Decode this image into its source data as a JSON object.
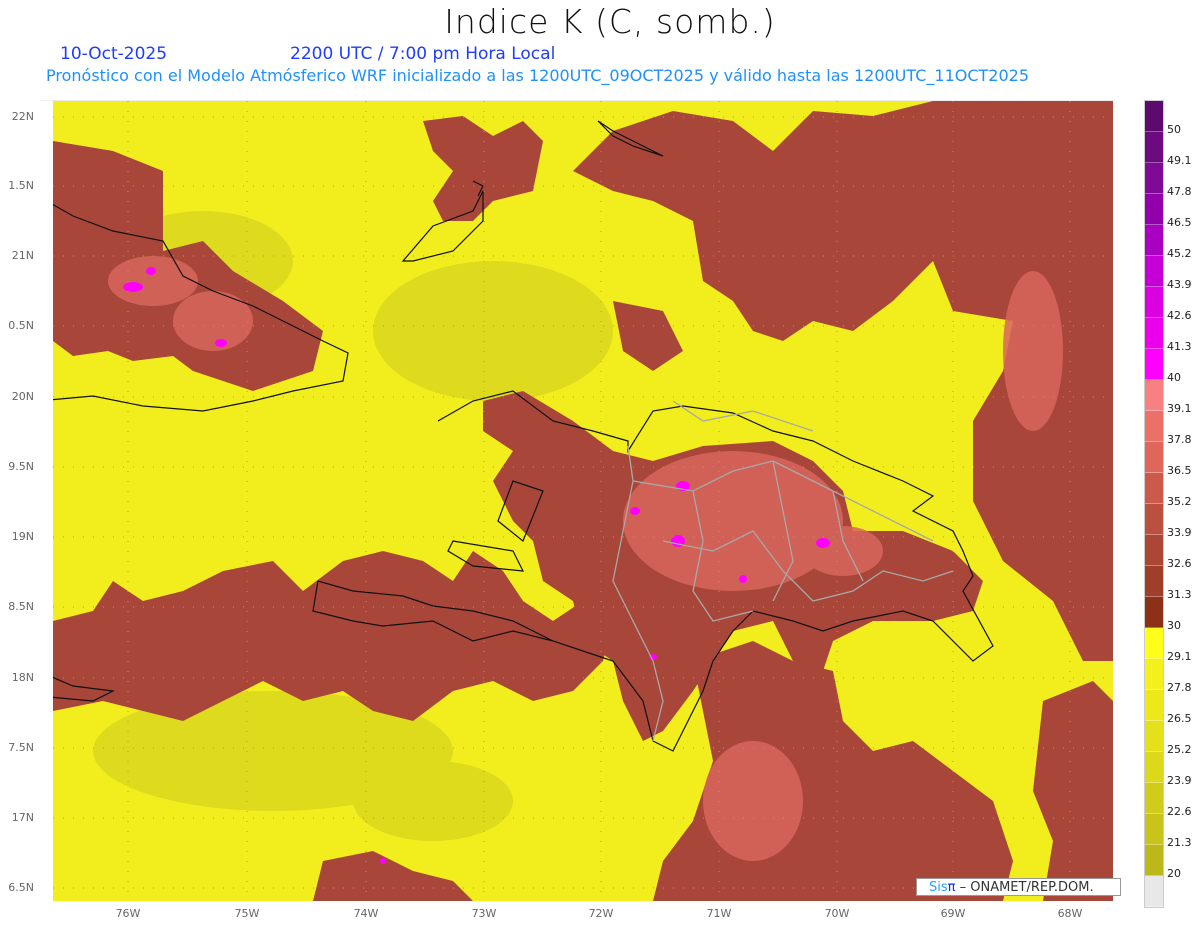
{
  "header": {
    "title": "Indice K (C, somb.)",
    "date": "10-Oct-2025",
    "time": "2200 UTC / 7:00 pm Hora Local",
    "subtitle": "Pronóstico con el Modelo Atmósferico WRF inicializado a las 1200UTC_09OCT2025 y válido hasta las  1200UTC_11OCT2025"
  },
  "axes": {
    "lat_labels": [
      "22N",
      "1.5N",
      "21N",
      "0.5N",
      "20N",
      "9.5N",
      "19N",
      "8.5N",
      "18N",
      "7.5N",
      "17N",
      "6.5N"
    ],
    "lon_labels": [
      "76W",
      "75W",
      "74W",
      "73W",
      "72W",
      "71W",
      "70W",
      "69W",
      "68W"
    ]
  },
  "colorbar": {
    "labels": [
      "50",
      "49.1",
      "47.8",
      "46.5",
      "45.2",
      "43.9",
      "42.6",
      "41.3",
      "40",
      "39.1",
      "37.8",
      "36.5",
      "35.2",
      "33.9",
      "32.6",
      "31.3",
      "30",
      "29.1",
      "27.8",
      "26.5",
      "25.2",
      "23.9",
      "22.6",
      "21.3",
      "20"
    ],
    "colors": [
      "#5c0a6e",
      "#6c0a80",
      "#7e0a96",
      "#9200ac",
      "#aa00c2",
      "#c400d6",
      "#da00e2",
      "#ec00ec",
      "#ff00ff",
      "#f98080",
      "#ec7068",
      "#e0665c",
      "#cc5a4c",
      "#bc5040",
      "#ac4636",
      "#a03e2c",
      "#8c3018",
      "#ffff1a",
      "#f4f01c",
      "#ece81a",
      "#e4e01a",
      "#dcd81a",
      "#d0cc1c",
      "#c8c41c",
      "#bcb81a",
      "#e8e8e8"
    ]
  },
  "credit": {
    "sis": "Sis",
    "pi": "π",
    "org": " – ONAMET/REP.DOM."
  }
}
